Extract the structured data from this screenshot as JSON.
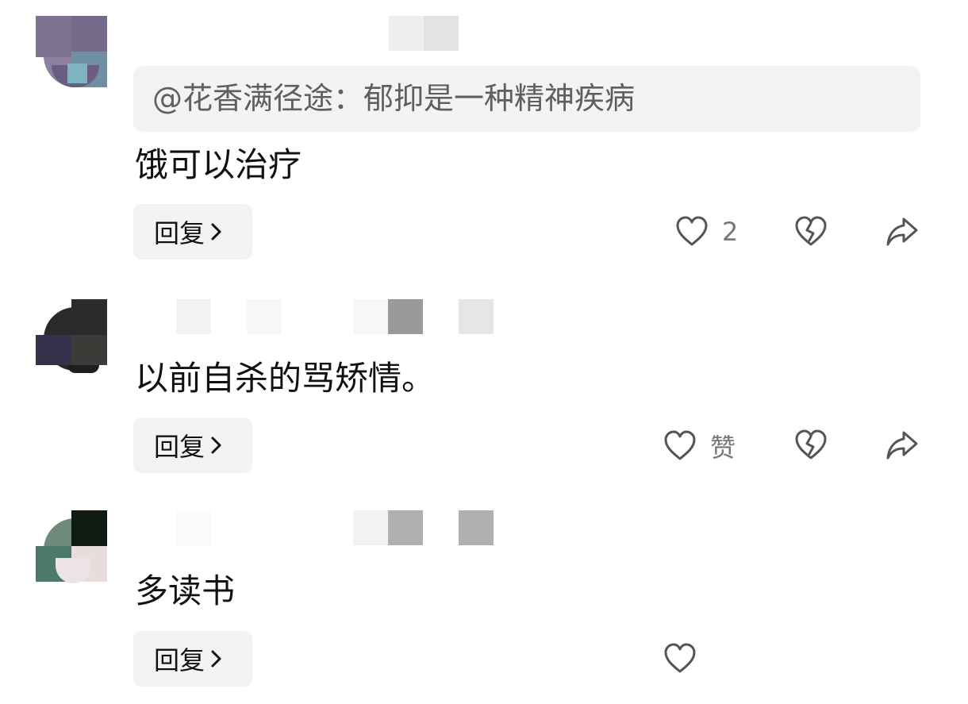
{
  "comments": [
    {
      "quote": "@花香满径途：郁抑是一种精神疾病",
      "text": "饿可以治疗",
      "reply_label": "回复",
      "like_label": "2",
      "like_icon": "heart-outline-icon",
      "dislike_icon": "broken-heart-icon",
      "share_icon": "share-arrow-icon"
    },
    {
      "text": "以前自杀的骂矫情。",
      "reply_label": "回复",
      "like_label": "赞",
      "like_icon": "heart-outline-icon",
      "dislike_icon": "broken-heart-icon",
      "share_icon": "share-arrow-icon"
    },
    {
      "text": "多读书",
      "reply_label": "回复",
      "like_icon": "heart-outline-icon"
    }
  ],
  "colors": {
    "quote_bg": "#f3f3f3",
    "button_bg": "#f3f3f3",
    "muted_text": "#777777",
    "icon_stroke": "#555555"
  }
}
